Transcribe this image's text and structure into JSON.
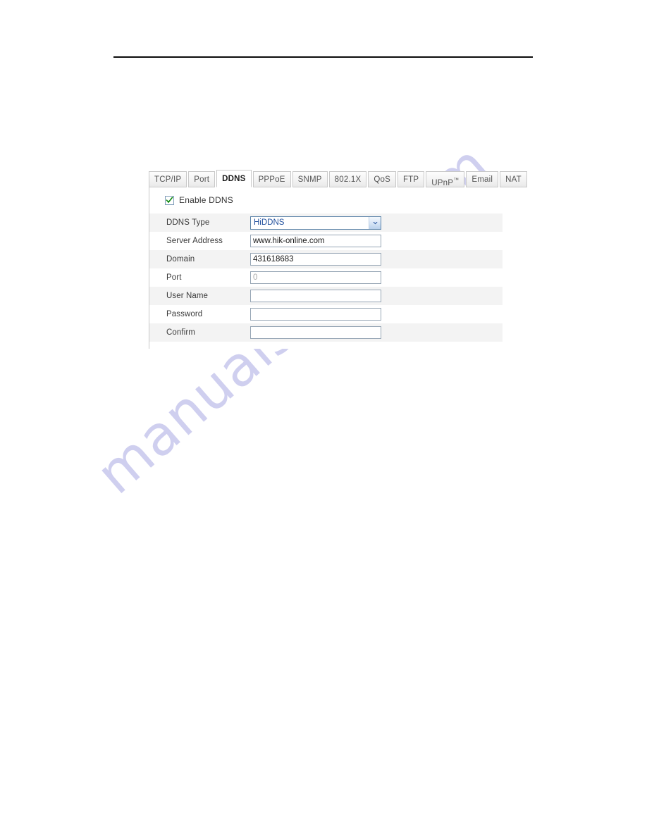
{
  "page": {
    "background_color": "#ffffff",
    "header_rule_color": "#0b0b0b"
  },
  "watermark": {
    "text": "manualshive.com",
    "color": "#ccccee"
  },
  "webui": {
    "tabs": [
      {
        "label": "TCP/IP",
        "active": false
      },
      {
        "label": "Port",
        "active": false
      },
      {
        "label": "DDNS",
        "active": true
      },
      {
        "label": "PPPoE",
        "active": false
      },
      {
        "label": "SNMP",
        "active": false
      },
      {
        "label": "802.1X",
        "active": false
      },
      {
        "label": "QoS",
        "active": false
      },
      {
        "label": "FTP",
        "active": false
      },
      {
        "label": "UPnP",
        "active": false,
        "trademark": "™"
      },
      {
        "label": "Email",
        "active": false
      },
      {
        "label": "NAT",
        "active": false
      }
    ],
    "enable_ddns": {
      "label": "Enable DDNS",
      "checked": true,
      "check_color": "#108a10"
    },
    "form": {
      "rows": [
        {
          "label": "DDNS Type",
          "type": "select",
          "value": "HiDDNS",
          "value_color": "#1f4e9c",
          "shaded": true
        },
        {
          "label": "Server Address",
          "type": "text",
          "value": "www.hik-online.com",
          "placeholder": "",
          "shaded": false
        },
        {
          "label": "Domain",
          "type": "text",
          "value": "431618683",
          "placeholder": "",
          "shaded": true
        },
        {
          "label": "Port",
          "type": "text",
          "value": "0",
          "placeholder": "",
          "disabled": true,
          "shaded": false
        },
        {
          "label": "User Name",
          "type": "text",
          "value": "",
          "placeholder": "",
          "shaded": true
        },
        {
          "label": "Password",
          "type": "password",
          "value": "",
          "placeholder": "",
          "shaded": false
        },
        {
          "label": "Confirm",
          "type": "password",
          "value": "",
          "placeholder": "",
          "shaded": true
        }
      ]
    }
  }
}
